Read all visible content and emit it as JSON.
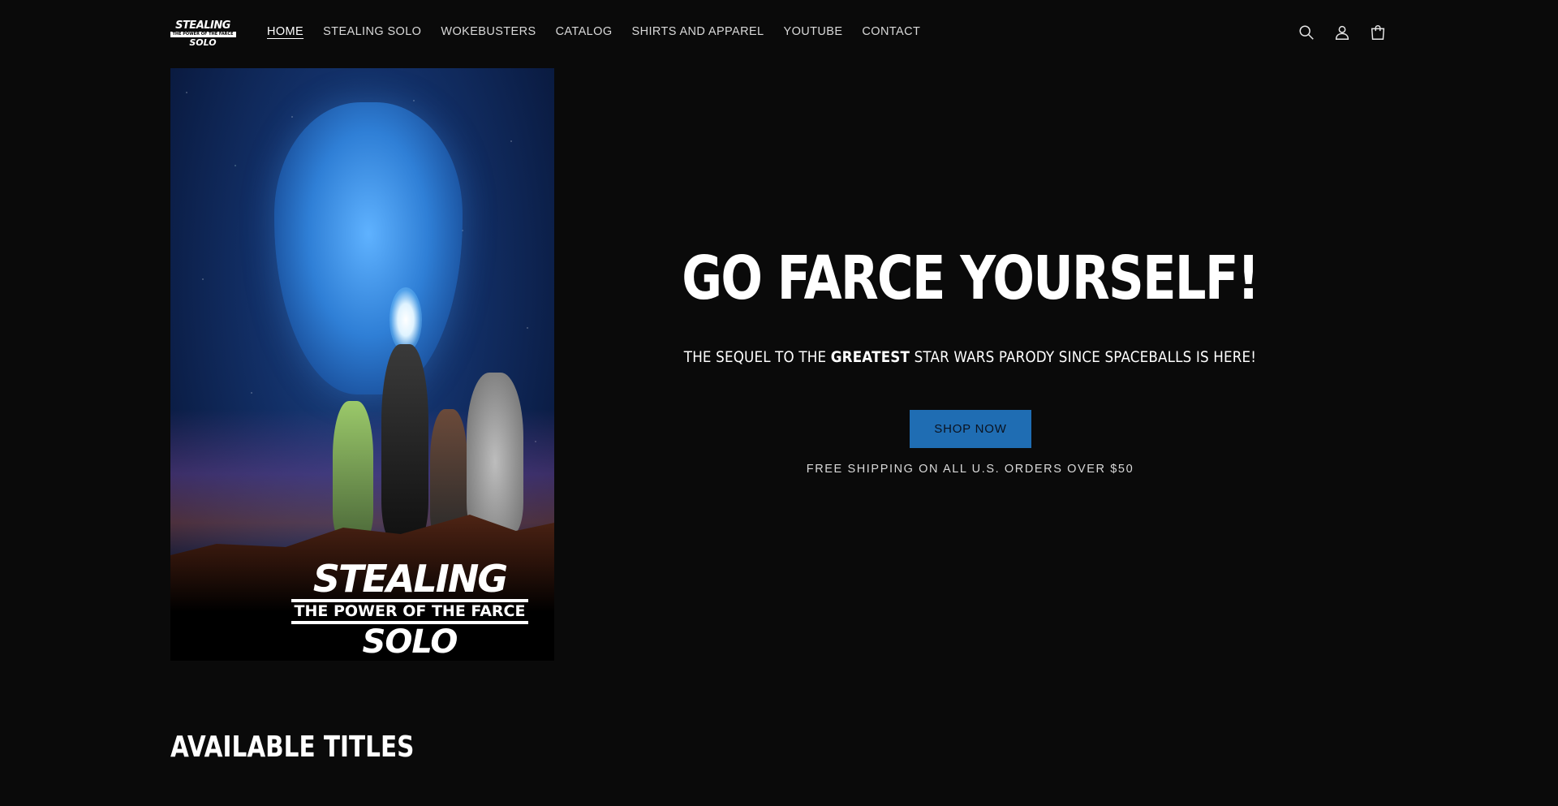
{
  "header": {
    "logo": {
      "line1": "STEALING",
      "line2": "THE POWER OF THE FARCE",
      "line3": "SOLO"
    },
    "nav": [
      {
        "label": "HOME",
        "active": true
      },
      {
        "label": "STEALING SOLO",
        "active": false
      },
      {
        "label": "WOKEBUSTERS",
        "active": false
      },
      {
        "label": "CATALOG",
        "active": false
      },
      {
        "label": "SHIRTS AND APPAREL",
        "active": false
      },
      {
        "label": "YOUTUBE",
        "active": false
      },
      {
        "label": "CONTACT",
        "active": false
      }
    ],
    "icons": [
      "search-icon",
      "account-icon",
      "cart-icon"
    ]
  },
  "hero": {
    "poster": {
      "title_line1": "STEALING",
      "title_line2": "THE POWER OF THE FARCE",
      "title_line3": "SOLO"
    },
    "heading": "GO FARCE YOURSELF!",
    "subheading_pre": "THE SEQUEL TO THE ",
    "subheading_bold": "GREATEST",
    "subheading_post": " STAR WARS PARODY SINCE SPACEBALLS IS HERE!",
    "button_label": "SHOP NOW",
    "shipping_note": "FREE SHIPPING ON ALL U.S. ORDERS OVER $50"
  },
  "section": {
    "title": "AVAILABLE TITLES"
  },
  "colors": {
    "background": "#0a0a0a",
    "button": "#1f6db3",
    "text": "#ffffff"
  }
}
